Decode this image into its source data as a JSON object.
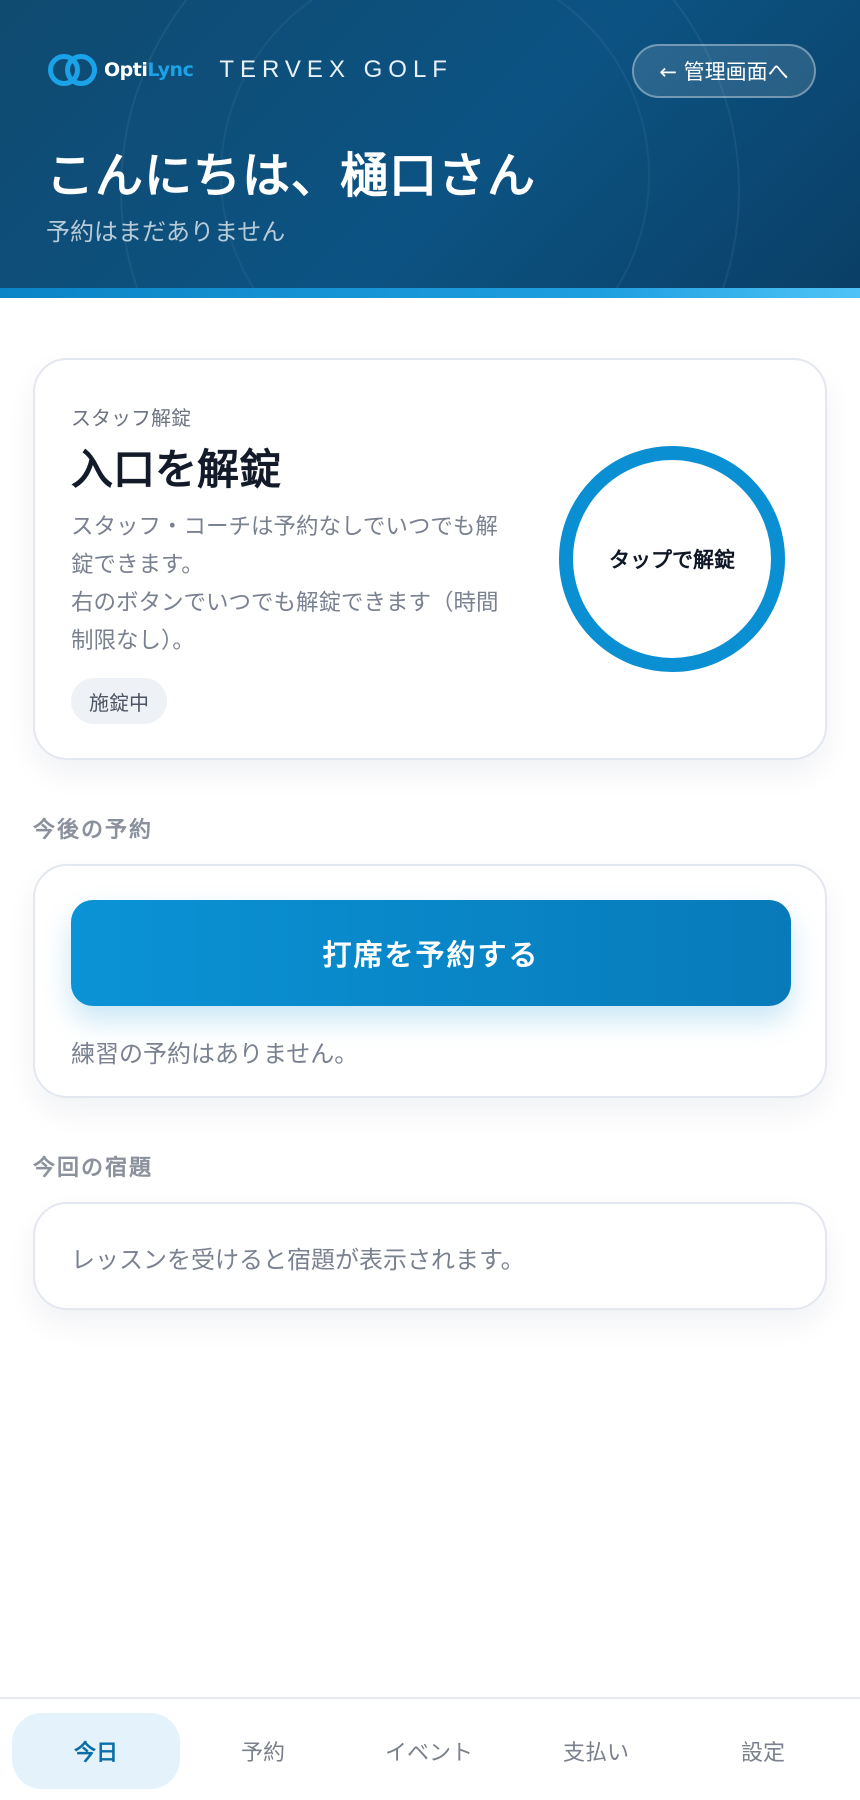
{
  "header": {
    "brand_opti": "Opti",
    "brand_lync": "Lync",
    "club_name": "TERVEX GOLF",
    "admin_button": "← 管理画面へ",
    "greeting": "こんにちは、樋口さん",
    "subtitle": "予約はまだありません"
  },
  "unlock": {
    "eyebrow": "スタッフ解錠",
    "title": "入口を解錠",
    "desc_lines": [
      "スタッフ・コーチは予約なしでいつでも解",
      "錠できます。",
      "右のボタンでいつでも解錠できます（時間",
      "制限なし）。"
    ],
    "status_badge": "施錠中",
    "circle_label": "タップで解錠"
  },
  "booking": {
    "section_label": "今後の予約",
    "button": "打席を予約する",
    "empty_text": "練習の予約はありません。"
  },
  "homework": {
    "section_label": "今回の宿題",
    "empty_text": "レッスンを受けると宿題が表示されます。"
  },
  "nav": {
    "items": [
      {
        "label": "今日",
        "active": true
      },
      {
        "label": "予約",
        "active": false
      },
      {
        "label": "イベント",
        "active": false
      },
      {
        "label": "支払い",
        "active": false
      },
      {
        "label": "設定",
        "active": false
      }
    ]
  },
  "colors": {
    "header_bg": "#0f4a70",
    "accent": "#0a8fd3",
    "nav_active_bg": "#e4f2fb"
  }
}
